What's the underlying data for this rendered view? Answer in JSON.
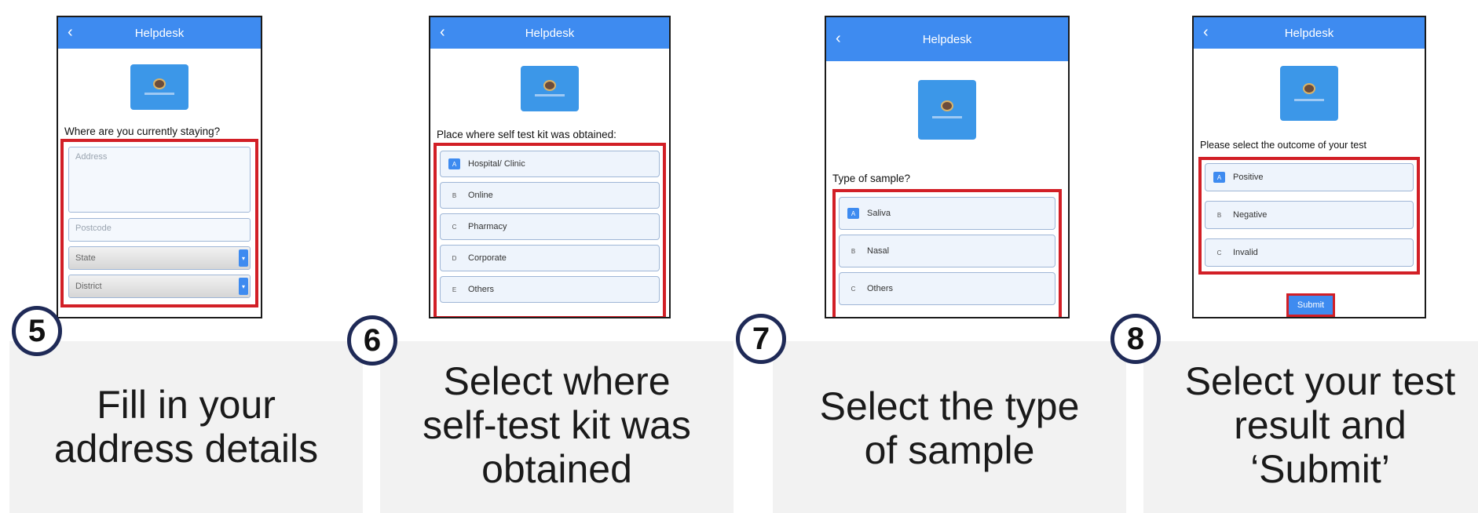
{
  "app_title": "Helpdesk",
  "back_icon": "chevron-left-icon",
  "logo_icon": "helpdesk-logo-icon",
  "colors": {
    "appbar": "#3e8bf0",
    "highlight": "#d21f26",
    "badge_border": "#1f2a57"
  },
  "steps": [
    {
      "number": "5",
      "question": "Where are you currently staying?",
      "fields": {
        "address_placeholder": "Address",
        "postcode_placeholder": "Postcode",
        "state_label": "State",
        "district_label": "District"
      },
      "caption": [
        "Fill in your",
        "address details"
      ]
    },
    {
      "number": "6",
      "question": "Place where self test kit was obtained:",
      "options": [
        {
          "key": "A",
          "label": "Hospital/ Clinic"
        },
        {
          "key": "B",
          "label": "Online"
        },
        {
          "key": "C",
          "label": "Pharmacy"
        },
        {
          "key": "D",
          "label": "Corporate"
        },
        {
          "key": "E",
          "label": "Others"
        }
      ],
      "caption": [
        "Select where",
        "self-test kit was",
        "obtained"
      ]
    },
    {
      "number": "7",
      "question": "Type of sample?",
      "options": [
        {
          "key": "A",
          "label": "Saliva"
        },
        {
          "key": "B",
          "label": "Nasal"
        },
        {
          "key": "C",
          "label": "Others"
        }
      ],
      "caption": [
        "Select the type",
        "of sample"
      ]
    },
    {
      "number": "8",
      "question": "Please select the outcome of your test",
      "options": [
        {
          "key": "A",
          "label": "Positive"
        },
        {
          "key": "B",
          "label": "Negative"
        },
        {
          "key": "C",
          "label": "Invalid"
        }
      ],
      "submit_label": "Submit",
      "caption": [
        "Select your test",
        "result and",
        "‘Submit’"
      ]
    }
  ]
}
